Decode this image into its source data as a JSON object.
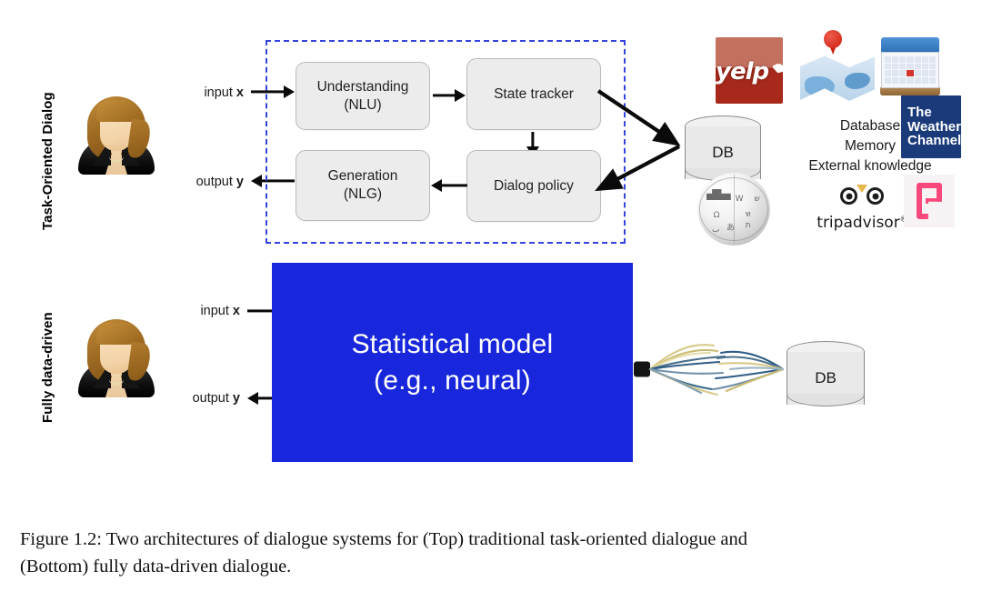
{
  "figure": {
    "caption_line1": "Figure 1.2:  Two architectures of dialogue systems for (Top) traditional task-oriented dialogue and",
    "caption_line2": "(Bottom) fully data-driven dialogue."
  },
  "top_section": {
    "row_label": "Task-Oriented Dialog",
    "user_avatar_name": "user-avatar",
    "input_label_prefix": "input ",
    "input_label_symbol": "x",
    "output_label_prefix": "output ",
    "output_label_symbol": "y",
    "modules": [
      {
        "id": "nlu",
        "line1": "Understanding",
        "line2": "(NLU)"
      },
      {
        "id": "state-tracker",
        "line1": "State tracker",
        "line2": ""
      },
      {
        "id": "dialog-policy",
        "line1": "Dialog policy",
        "line2": ""
      },
      {
        "id": "nlg",
        "line1": "Generation",
        "line2": "(NLG)"
      }
    ],
    "database": {
      "label": "DB"
    },
    "knowledge_sources_text": [
      "Database",
      "Memory",
      "External knowledge"
    ],
    "logos": [
      {
        "id": "yelp",
        "text": "yelp",
        "color": "#a7291b"
      },
      {
        "id": "maps",
        "text": "",
        "color": "#cc1f10"
      },
      {
        "id": "calendar",
        "text": "",
        "color": "#2c6fb5"
      },
      {
        "id": "weather-channel",
        "line1": "The",
        "line2": "Weather",
        "line3": "Channel",
        "color": "#1a3a7a"
      },
      {
        "id": "wikipedia",
        "text": "",
        "color": "#9d9d9d"
      },
      {
        "id": "tripadvisor",
        "text": "tripadvisor",
        "trademark": "®",
        "color": "#1a1a1a"
      },
      {
        "id": "foursquare",
        "text": "",
        "color": "#f9487c"
      }
    ]
  },
  "bottom_section": {
    "row_label": "Fully data-driven",
    "user_avatar_name": "user-avatar",
    "input_label_prefix": "input ",
    "input_label_symbol": "x",
    "output_label_prefix": "output ",
    "output_label_symbol": "y",
    "model_box": {
      "line1": "Statistical model",
      "line2": "(e.g., neural)",
      "color": "#1826dc"
    },
    "database": {
      "label": "DB"
    }
  },
  "colors": {
    "model_blue": "#1826dc",
    "dashed_border": "#3344dd",
    "module_fill": "#ececed",
    "db_fill": "#e9e9ea",
    "arrow": "#0a0a0a"
  }
}
